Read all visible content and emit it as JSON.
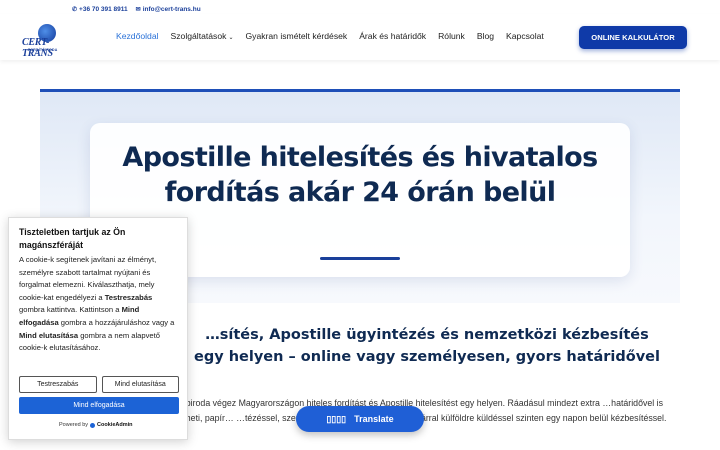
{
  "topbar": {
    "phone": "+36 70 391 8911",
    "email": "info@cert-trans.hu",
    "phone_icon": "phone-icon",
    "email_icon": "envelope-icon"
  },
  "logo": {
    "word": "CERT-TRANS",
    "sub": "FORDÍTÓIRODA"
  },
  "nav": {
    "items": [
      {
        "label": "Kezdőoldal"
      },
      {
        "label": "Szolgáltatások"
      },
      {
        "label": "Gyakran ismételt kérdések"
      },
      {
        "label": "Árak és határidők"
      },
      {
        "label": "Rólunk"
      },
      {
        "label": "Blog"
      },
      {
        "label": "Kapcsolat"
      }
    ],
    "cta": "ONLINE KALKULÁTOR"
  },
  "hero": {
    "title": "Apostille hitelesítés és hivatalos fordítás akár 24 órán belül"
  },
  "subtitle": "…sítés, Apostille ügyintézés és nemzetközi kézbesítés egy helyen – online vagy személyesen, gyors határidővel",
  "body_text": "…biroda végez Magyarországon hiteles fordítást és Apostille hitelesítést egy helyen. Ráadásul mindezt extra …határidővel is kérheti, papír… …tézéssel, személyes átvétellel vagy Fedex futárral külföldre küldéssel szinten egy napon belül kézbesítéssel.",
  "translate": {
    "label": "Translate",
    "glyphs": "▯▯▯▯"
  },
  "cookie": {
    "title": "Tiszteletben tartjuk az Ön magánszféráját",
    "text_1": "A cookie-k segítenek javítani az élményt, személyre szabott tartalmat nyújtani és forgalmat elemezni. Kiválaszthatja, mely cookie-kat engedélyezi a ",
    "text_b1": "Testreszabás",
    "text_2": " gombra kattintva. Kattintson a ",
    "text_b2": "Mind elfogadása",
    "text_3": " gombra a hozzájáruláshoz vagy a ",
    "text_b3": "Mind elutasítása",
    "text_4": " gombra a nem alapvető cookie-k elutasításához.",
    "customize": "Testreszabás",
    "reject": "Mind elutasítása",
    "accept": "Mind elfogadása",
    "powered_prefix": "Powered by",
    "powered_brand": "CookieAdmin"
  },
  "colors": {
    "brand": "#1a3f9a",
    "accent": "#2b72d8",
    "cta": "#0f3aa8"
  }
}
